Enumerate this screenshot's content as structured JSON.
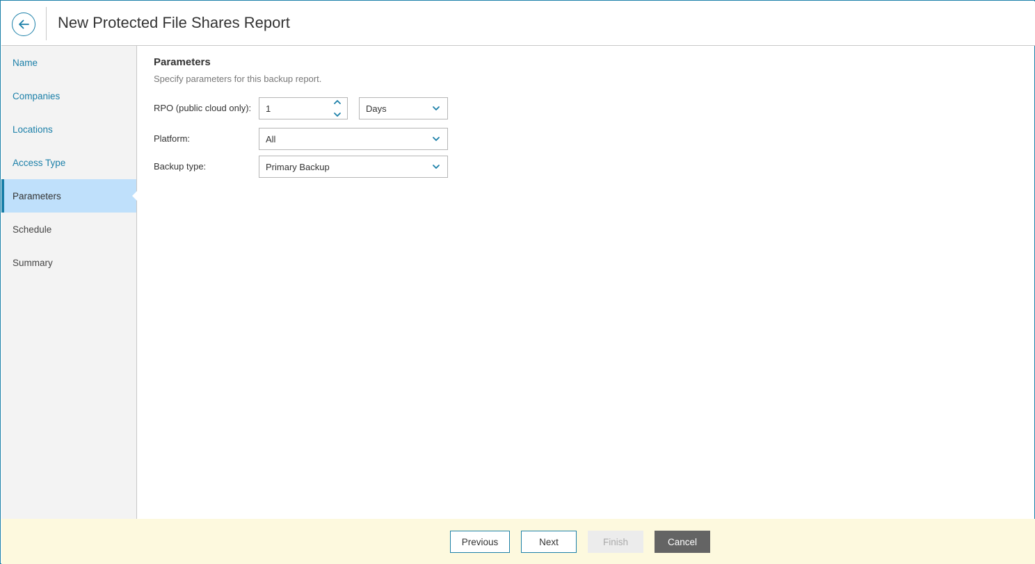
{
  "header": {
    "title": "New Protected File Shares Report",
    "back_icon": "arrow-left-icon"
  },
  "sidebar": {
    "items": [
      {
        "label": "Name",
        "state": "link"
      },
      {
        "label": "Companies",
        "state": "link"
      },
      {
        "label": "Locations",
        "state": "link"
      },
      {
        "label": "Access Type",
        "state": "link"
      },
      {
        "label": "Parameters",
        "state": "active"
      },
      {
        "label": "Schedule",
        "state": "plain"
      },
      {
        "label": "Summary",
        "state": "plain"
      }
    ]
  },
  "main": {
    "title": "Parameters",
    "description": "Specify parameters for this backup report.",
    "rpo": {
      "label": "RPO (public cloud only):",
      "value": "1",
      "unit": "Days"
    },
    "platform": {
      "label": "Platform:",
      "value": "All"
    },
    "backup_type": {
      "label": "Backup type:",
      "value": "Primary Backup"
    }
  },
  "footer": {
    "previous_label": "Previous",
    "next_label": "Next",
    "finish_label": "Finish",
    "cancel_label": "Cancel"
  },
  "colors": {
    "accent": "#1a7fa8",
    "active_nav_bg": "#bfe0fb",
    "footer_bg": "#fdf9de",
    "cancel_bg": "#646464"
  }
}
